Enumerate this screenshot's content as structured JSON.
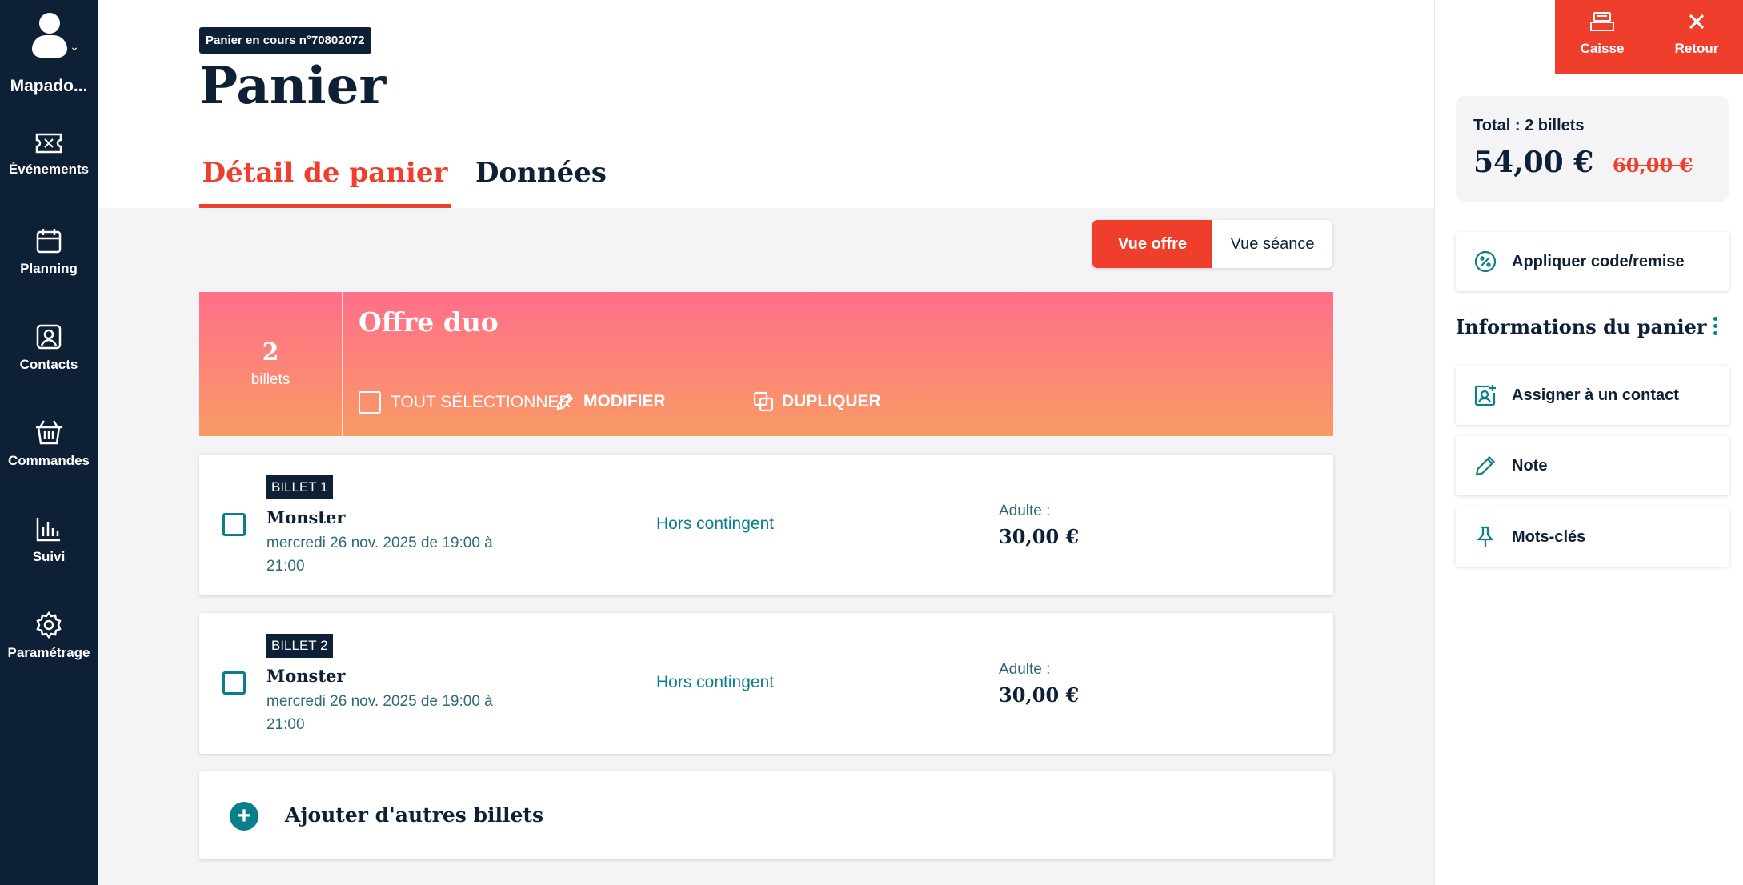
{
  "sidebar": {
    "user_name": "Mapado...",
    "items": [
      {
        "label": "Événements",
        "icon": "ticket-icon"
      },
      {
        "label": "Planning",
        "icon": "calendar-icon"
      },
      {
        "label": "Contacts",
        "icon": "contact-card-icon"
      },
      {
        "label": "Commandes",
        "icon": "basket-icon"
      },
      {
        "label": "Suivi",
        "icon": "bar-chart-icon"
      },
      {
        "label": "Paramétrage",
        "icon": "gear-icon"
      }
    ]
  },
  "header": {
    "cart_badge": "Panier en cours n°70802072",
    "title": "Panier",
    "tabs": [
      {
        "label": "Détail de panier",
        "active": true
      },
      {
        "label": "Données",
        "active": false
      }
    ]
  },
  "view_toggle": {
    "options": [
      "Vue offre",
      "Vue séance"
    ],
    "selected": "Vue offre"
  },
  "offer": {
    "count": "2",
    "count_label": "billets",
    "title": "Offre duo",
    "actions": {
      "select_all": "TOUT SÉLECTIONNER",
      "modify": "MODIFIER",
      "duplicate": "DUPLIQUER"
    }
  },
  "tickets": [
    {
      "tag": "BILLET 1",
      "event": "Monster",
      "date": "mercredi 26 nov. 2025 de 19:00 à 21:00",
      "contingent": "Hors contingent",
      "rate": "Adulte :",
      "price": "30,00 €"
    },
    {
      "tag": "BILLET 2",
      "event": "Monster",
      "date": "mercredi 26 nov. 2025 de 19:00 à 21:00",
      "contingent": "Hors contingent",
      "rate": "Adulte :",
      "price": "30,00 €"
    }
  ],
  "add_tickets": "Ajouter d'autres billets",
  "right_panel": {
    "top_buttons": [
      {
        "label": "Caisse",
        "icon": "cash-register-icon"
      },
      {
        "label": "Retour",
        "icon": "close-icon"
      }
    ],
    "total_label": "Total : 2 billets",
    "total_price": "54,00 €",
    "old_price": "60,00 €",
    "apply_code": "Appliquer code/remise",
    "info_title": "Informations du panier",
    "assign_contact": "Assigner à un contact",
    "note": "Note",
    "keywords": "Mots-clés"
  },
  "colors": {
    "navy": "#0d2036",
    "accent": "#f03e2d",
    "teal": "#0a7f8c",
    "offer_gradient_top": "#ff6f8a",
    "offer_gradient_bottom": "#f99a65"
  }
}
